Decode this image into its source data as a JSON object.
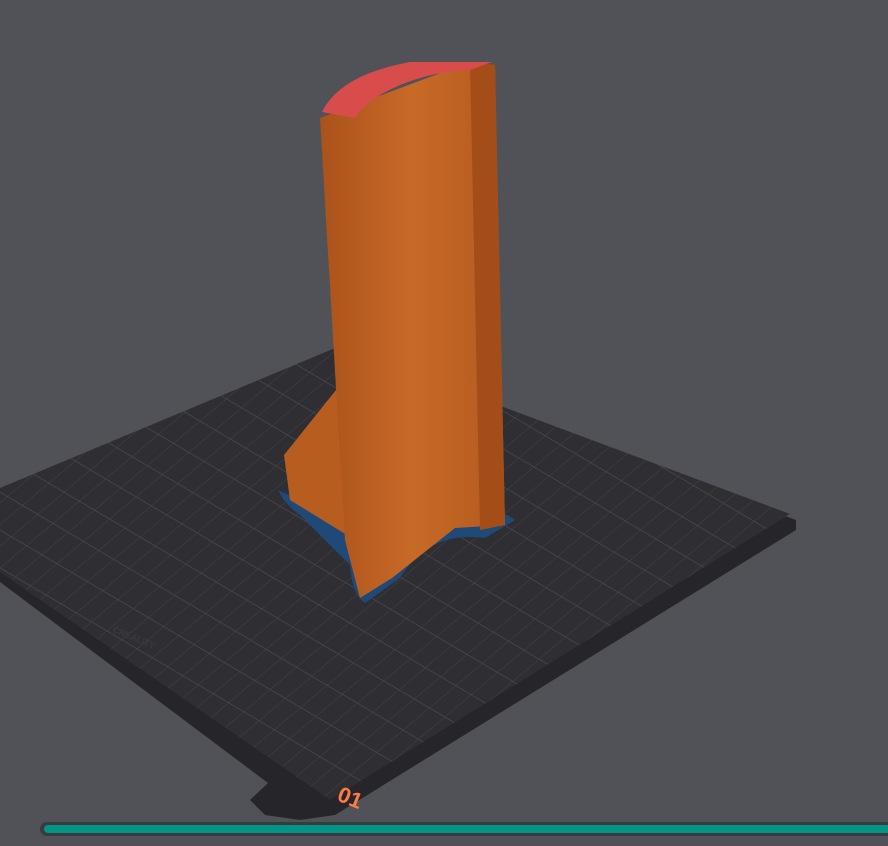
{
  "viewport": {
    "plate_number": "01",
    "bed_logo": "CREALITY",
    "colors": {
      "background": "#515158",
      "bed": "#2e2e33",
      "model": "#c0601f",
      "top_surface": "#d94c4c",
      "first_layer": "#1f4a78",
      "accent": "#009688"
    }
  },
  "layer_slider": {
    "progress_percent": 100
  }
}
